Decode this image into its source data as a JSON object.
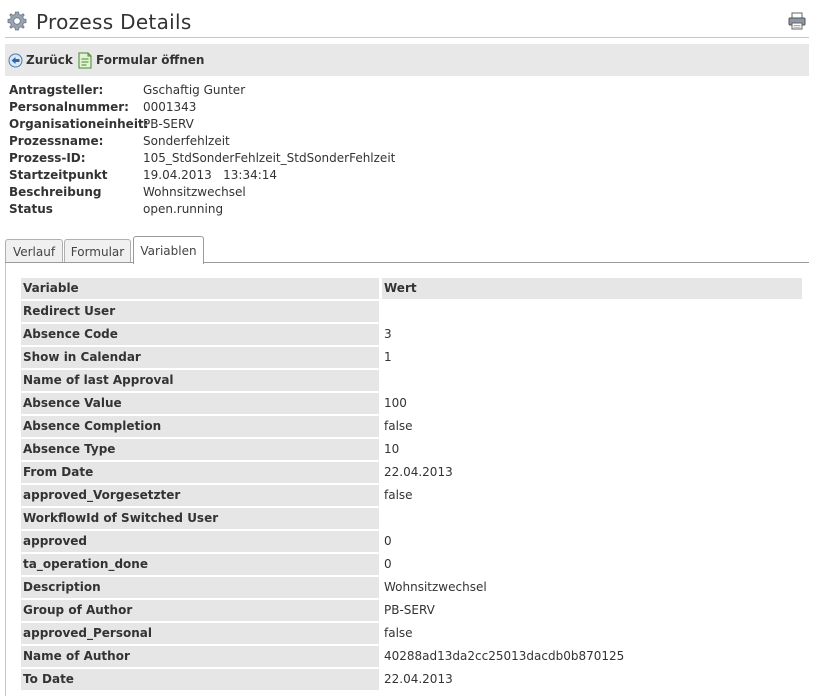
{
  "header": {
    "title": "Prozess Details",
    "gear_icon": "gear-icon",
    "print_icon": "printer-icon"
  },
  "toolbar": {
    "back_label": "Zurück",
    "open_form_label": "Formular öffnen"
  },
  "info": [
    {
      "label": "Antragsteller:",
      "value": "Gschaftig Gunter"
    },
    {
      "label": "Personalnummer:",
      "value": "0001343"
    },
    {
      "label": "Organisationeinheit:",
      "value": "PB-SERV"
    },
    {
      "label": "Prozessname:",
      "value": "Sonderfehlzeit"
    },
    {
      "label": "Prozess-ID:",
      "value": "105_StdSonderFehlzeit_StdSonderFehlzeit"
    },
    {
      "label": "Startzeitpunkt",
      "value": "19.04.2013   13:34:14"
    },
    {
      "label": "Beschreibung",
      "value": "Wohnsitzwechsel"
    },
    {
      "label": "Status",
      "value": "open.running"
    }
  ],
  "tabs": [
    {
      "label": "Verlauf"
    },
    {
      "label": "Formular"
    },
    {
      "label": "Variablen",
      "active": true
    }
  ],
  "variables": {
    "header": {
      "name": "Variable",
      "value": "Wert"
    },
    "rows": [
      {
        "name": "Redirect User",
        "value": ""
      },
      {
        "name": "Absence Code",
        "value": "3"
      },
      {
        "name": "Show in Calendar",
        "value": "1"
      },
      {
        "name": "Name of last Approval",
        "value": ""
      },
      {
        "name": "Absence Value",
        "value": "100"
      },
      {
        "name": "Absence Completion",
        "value": "false"
      },
      {
        "name": "Absence Type",
        "value": "10"
      },
      {
        "name": "From Date",
        "value": "22.04.2013"
      },
      {
        "name": "approved_Vorgesetzter",
        "value": "false"
      },
      {
        "name": "WorkflowId of Switched User",
        "value": ""
      },
      {
        "name": "approved",
        "value": "0"
      },
      {
        "name": "ta_operation_done",
        "value": "0"
      },
      {
        "name": "Description",
        "value": "Wohnsitzwechsel"
      },
      {
        "name": "Group of Author",
        "value": "PB-SERV"
      },
      {
        "name": "approved_Personal",
        "value": "false"
      },
      {
        "name": "Name of Author",
        "value": "40288ad13da2cc25013dacdb0b870125"
      },
      {
        "name": "To Date",
        "value": "22.04.2013"
      }
    ]
  }
}
